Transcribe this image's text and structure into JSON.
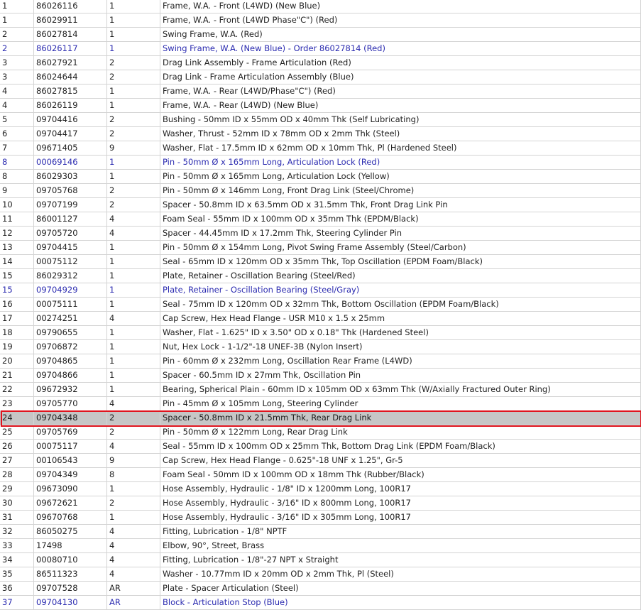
{
  "table": {
    "selected_index": 25,
    "rows": [
      {
        "ref": "1",
        "part": "86026116",
        "qty": "1",
        "desc": "Frame, W.A. - Front (L4WD) (New Blue)",
        "alt": false
      },
      {
        "ref": "1",
        "part": "86029911",
        "qty": "1",
        "desc": "Frame, W.A. - Front (L4WD Phase\"C\") (Red)",
        "alt": false
      },
      {
        "ref": "2",
        "part": "86027814",
        "qty": "1",
        "desc": "Swing Frame, W.A. (Red)",
        "alt": false
      },
      {
        "ref": "2",
        "part": "86026117",
        "qty": "1",
        "desc": "Swing Frame, W.A. (New Blue) - Order 86027814 (Red)",
        "alt": true
      },
      {
        "ref": "3",
        "part": "86027921",
        "qty": "2",
        "desc": "Drag Link Assembly - Frame Articulation (Red)",
        "alt": false
      },
      {
        "ref": "3",
        "part": "86024644",
        "qty": "2",
        "desc": "Drag Link - Frame Articulation Assembly (Blue)",
        "alt": false
      },
      {
        "ref": "4",
        "part": "86027815",
        "qty": "1",
        "desc": "Frame, W.A. - Rear (L4WD/Phase\"C\") (Red)",
        "alt": false
      },
      {
        "ref": "4",
        "part": "86026119",
        "qty": "1",
        "desc": "Frame, W.A. - Rear (L4WD) (New Blue)",
        "alt": false
      },
      {
        "ref": "5",
        "part": "09704416",
        "qty": "2",
        "desc": "Bushing - 50mm ID x 55mm OD x 40mm Thk (Self Lubricating)",
        "alt": false
      },
      {
        "ref": "6",
        "part": "09704417",
        "qty": "2",
        "desc": "Washer, Thrust - 52mm ID x 78mm OD x 2mm Thk (Steel)",
        "alt": false
      },
      {
        "ref": "7",
        "part": "09671405",
        "qty": "9",
        "desc": "Washer, Flat - 17.5mm ID x 62mm OD x 10mm Thk, Pl (Hardened Steel)",
        "alt": false
      },
      {
        "ref": "8",
        "part": "00069146",
        "qty": "1",
        "desc": "Pin - 50mm Ø x 165mm Long, Articulation Lock (Red)",
        "alt": true
      },
      {
        "ref": "8",
        "part": "86029303",
        "qty": "1",
        "desc": "Pin - 50mm Ø x 165mm Long, Articulation Lock (Yellow)",
        "alt": false
      },
      {
        "ref": "9",
        "part": "09705768",
        "qty": "2",
        "desc": "Pin - 50mm Ø x 146mm Long, Front Drag Link (Steel/Chrome)",
        "alt": false
      },
      {
        "ref": "10",
        "part": "09707199",
        "qty": "2",
        "desc": "Spacer - 50.8mm ID x 63.5mm OD x 31.5mm Thk, Front Drag Link Pin",
        "alt": false
      },
      {
        "ref": "11",
        "part": "86001127",
        "qty": "4",
        "desc": "Foam Seal - 55mm ID x 100mm OD x 35mm Thk (EPDM/Black)",
        "alt": false
      },
      {
        "ref": "12",
        "part": "09705720",
        "qty": "4",
        "desc": "Spacer - 44.45mm ID x 17.2mm Thk, Steering Cylinder Pin",
        "alt": false
      },
      {
        "ref": "13",
        "part": "09704415",
        "qty": "1",
        "desc": "Pin - 50mm Ø x 154mm Long, Pivot Swing Frame Assembly (Steel/Carbon)",
        "alt": false
      },
      {
        "ref": "14",
        "part": "00075112",
        "qty": "1",
        "desc": "Seal - 65mm ID x 120mm OD x 35mm Thk, Top Oscillation (EPDM Foam/Black)",
        "alt": false
      },
      {
        "ref": "15",
        "part": "86029312",
        "qty": "1",
        "desc": "Plate, Retainer - Oscillation Bearing (Steel/Red)",
        "alt": false
      },
      {
        "ref": "15",
        "part": "09704929",
        "qty": "1",
        "desc": "Plate, Retainer - Oscillation Bearing (Steel/Gray)",
        "alt": true
      },
      {
        "ref": "16",
        "part": "00075111",
        "qty": "1",
        "desc": "Seal - 75mm ID x 120mm OD x 32mm Thk, Bottom Oscillation (EPDM Foam/Black)",
        "alt": false
      },
      {
        "ref": "17",
        "part": "00274251",
        "qty": "4",
        "desc": "Cap Screw, Hex Head Flange - USR M10 x 1.5 x 25mm",
        "alt": false
      },
      {
        "ref": "18",
        "part": "09790655",
        "qty": "1",
        "desc": "Washer, Flat - 1.625\" ID x 3.50\" OD x 0.18\" Thk (Hardened Steel)",
        "alt": false
      },
      {
        "ref": "19",
        "part": "09706872",
        "qty": "1",
        "desc": "Nut, Hex Lock - 1-1/2\"-18 UNEF-3B (Nylon Insert)",
        "alt": false
      },
      {
        "ref": "20",
        "part": "09704865",
        "qty": "1",
        "desc": "Pin - 60mm Ø x 232mm Long, Oscillation Rear Frame (L4WD)",
        "alt": false
      },
      {
        "ref": "21",
        "part": "09704866",
        "qty": "1",
        "desc": "Spacer - 60.5mm ID x 27mm Thk, Oscillation Pin",
        "alt": false
      },
      {
        "ref": "22",
        "part": "09672932",
        "qty": "1",
        "desc": "Bearing, Spherical Plain - 60mm ID x 105mm OD x 63mm Thk (W/Axially Fractured Outer Ring)",
        "alt": false
      },
      {
        "ref": "23",
        "part": "09705770",
        "qty": "4",
        "desc": "Pin - 45mm Ø x 105mm Long, Steering Cylinder",
        "alt": false
      },
      {
        "ref": "24",
        "part": "09704348",
        "qty": "2",
        "desc": "Spacer - 50.8mm ID x 21.5mm Thk, Rear Drag Link",
        "alt": false,
        "selected": true
      },
      {
        "ref": "25",
        "part": "09705769",
        "qty": "2",
        "desc": "Pin - 50mm Ø x 122mm Long, Rear Drag Link",
        "alt": false
      },
      {
        "ref": "26",
        "part": "00075117",
        "qty": "4",
        "desc": "Seal - 55mm ID x 100mm OD x 25mm Thk, Bottom Drag Link (EPDM Foam/Black)",
        "alt": false
      },
      {
        "ref": "27",
        "part": "00106543",
        "qty": "9",
        "desc": "Cap Screw, Hex Head Flange - 0.625\"-18 UNF x 1.25\", Gr-5",
        "alt": false
      },
      {
        "ref": "28",
        "part": "09704349",
        "qty": "8",
        "desc": "Foam Seal - 50mm ID x 100mm OD x 18mm Thk (Rubber/Black)",
        "alt": false
      },
      {
        "ref": "29",
        "part": "09673090",
        "qty": "1",
        "desc": "Hose Assembly, Hydraulic - 1/8\" ID x 1200mm Long, 100R17",
        "alt": false
      },
      {
        "ref": "30",
        "part": "09672621",
        "qty": "2",
        "desc": "Hose Assembly, Hydraulic - 3/16\" ID x 800mm Long, 100R17",
        "alt": false
      },
      {
        "ref": "31",
        "part": "09670768",
        "qty": "1",
        "desc": "Hose Assembly, Hydraulic - 3/16\" ID x 305mm Long, 100R17",
        "alt": false
      },
      {
        "ref": "32",
        "part": "86050275",
        "qty": "4",
        "desc": "Fitting, Lubrication - 1/8\" NPTF",
        "alt": false
      },
      {
        "ref": "33",
        "part": "17498",
        "qty": "4",
        "desc": "Elbow, 90°, Street, Brass",
        "alt": false
      },
      {
        "ref": "34",
        "part": "00080710",
        "qty": "4",
        "desc": "Fitting, Lubrication - 1/8\"-27 NPT x Straight",
        "alt": false
      },
      {
        "ref": "35",
        "part": "86511323",
        "qty": "4",
        "desc": "Washer - 10.77mm ID x 20mm OD x 2mm Thk, Pl (Steel)",
        "alt": false
      },
      {
        "ref": "36",
        "part": "09707528",
        "qty": "AR",
        "desc": "Plate - Spacer Articulation (Steel)",
        "alt": false
      },
      {
        "ref": "37",
        "part": "09704130",
        "qty": "AR",
        "desc": "Block - Articulation Stop (Blue)",
        "alt": true
      }
    ]
  },
  "colors": {
    "text": "#222222",
    "alt_text": "#2b2bb0",
    "selected_bg": "#c6c6c6",
    "highlight_outline": "#e0141e",
    "grid": "#d4d4d4"
  }
}
